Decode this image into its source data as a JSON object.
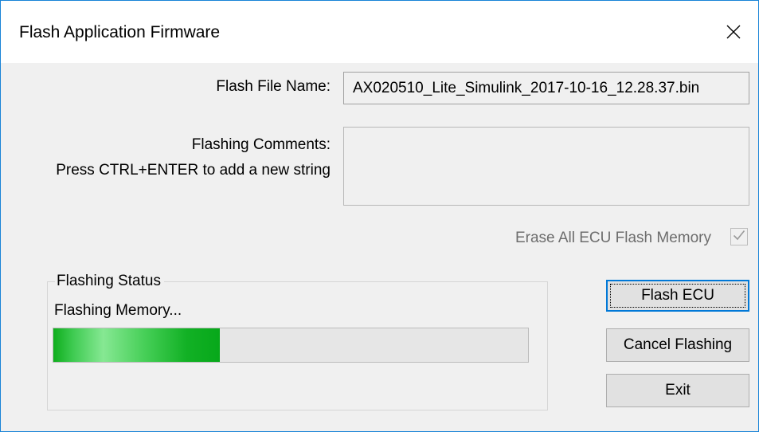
{
  "window": {
    "title": "Flash Application Firmware",
    "close_icon": "close-icon"
  },
  "file": {
    "label": "Flash File Name:",
    "value": "AX020510_Lite_Simulink_2017-10-16_12.28.37.bin"
  },
  "comments": {
    "label_line1": "Flashing Comments:",
    "label_line2": "Press CTRL+ENTER to add a new string",
    "value": ""
  },
  "erase": {
    "label": "Erase All ECU Flash Memory",
    "checked": true,
    "enabled": false
  },
  "status": {
    "group_title": "Flashing Status",
    "text": "Flashing Memory...",
    "progress": 0.35,
    "progress_color": "#12b125"
  },
  "buttons": {
    "flash": "Flash ECU",
    "cancel": "Cancel Flashing",
    "exit": "Exit"
  },
  "colors": {
    "window_border": "#1883d7",
    "dialog_bg": "#f0f0f0",
    "focus_border": "#0078d7"
  }
}
